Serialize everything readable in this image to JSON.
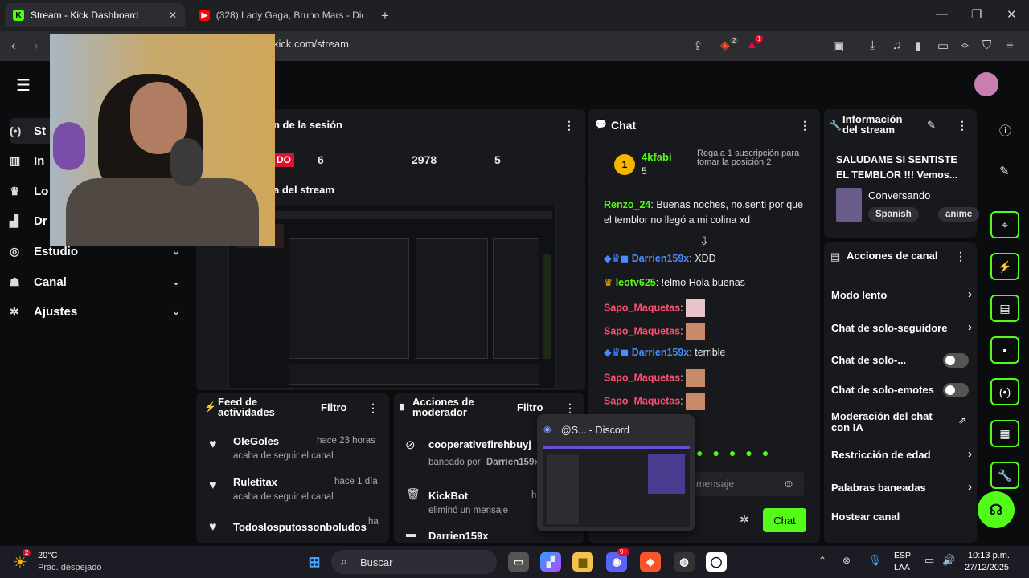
{
  "browser": {
    "tabs": [
      {
        "label": "Stream - Kick Dashboard",
        "icon": "kick-icon",
        "active": true
      },
      {
        "label": "(328) Lady Gaga, Bruno Mars - Die W",
        "icon": "youtube-icon",
        "active": false
      }
    ],
    "url": "kick.com/stream",
    "shield_badge": "2",
    "alert_badge": "1"
  },
  "sidebar": {
    "items": [
      {
        "label": "St",
        "icon": "broadcast-icon"
      },
      {
        "label": "In",
        "icon": "chart-icon"
      },
      {
        "label": "Lo",
        "icon": "trophy-icon"
      },
      {
        "label": "Dr",
        "icon": "drops-icon"
      },
      {
        "label": "Estudio",
        "icon": "studio-icon"
      },
      {
        "label": "Canal",
        "icon": "channel-icon"
      },
      {
        "label": "Ajustes",
        "icon": "settings-icon"
      }
    ]
  },
  "session": {
    "title": "n de la sesión",
    "live_label": "DO",
    "stats": [
      "6",
      "2978",
      "5"
    ],
    "preview_title": "a del stream"
  },
  "feed": {
    "title": "Feed de actividades",
    "filter": "Filtro",
    "items": [
      {
        "name": "OleGoles",
        "sub": "acaba de seguir el canal",
        "time": "hace 23 horas"
      },
      {
        "name": "Ruletitax",
        "sub": "acaba de seguir el canal",
        "time": "hace 1 día"
      },
      {
        "name": "Todoslosputossonboludos",
        "sub": "",
        "time": "ha"
      }
    ]
  },
  "modactions": {
    "title": "Acciones de moderador",
    "filter": "Filtro",
    "items": [
      {
        "name": "cooperativefirehbuyj",
        "sub": "baneado por",
        "by": "Darrien159x"
      },
      {
        "name": "KickBot",
        "sub": "eliminó un mensaje",
        "time": "h"
      },
      {
        "name": "Darrien159x",
        "sub": ""
      }
    ]
  },
  "chat": {
    "title": "Chat",
    "gifter": {
      "name": "4kfabi",
      "rank": "1",
      "count": "5",
      "promo": "Regala 1 suscripción para tomar la posición 2"
    },
    "messages": [
      {
        "user": "Renzo_24",
        "text": "Buenas noches, no.senti por que el temblor no llegó a mi colina xd",
        "color": "#53fc18"
      },
      {
        "user": "Darrien159x",
        "text": "XDD",
        "color": "#4a8cff"
      },
      {
        "user": "leotv625",
        "text": "!elmo Hola buenas",
        "color": "#53fc18"
      },
      {
        "user": "Sapo_Maquetas",
        "text": "",
        "color": "#ff4d6d"
      },
      {
        "user": "Sapo_Maquetas",
        "text": "",
        "color": "#ff4d6d"
      },
      {
        "user": "Darrien159x",
        "text": "terrible",
        "color": "#4a8cff"
      },
      {
        "user": "Sapo_Maquetas",
        "text": "",
        "color": "#ff4d6d"
      },
      {
        "user": "Sapo_Maquetas",
        "text": "",
        "color": "#ff4d6d"
      }
    ],
    "input_placeholder": "mensaje",
    "send_label": "Chat"
  },
  "discord_popup": {
    "title": "@S... - Discord"
  },
  "info": {
    "title": "Información del stream",
    "stream_title": "SALUDAME SI SENTISTE EL TEMBLOR !!! Vemos...",
    "category": "Conversando",
    "tags": [
      "Spanish",
      "anime"
    ]
  },
  "channel_actions": {
    "title": "Acciones de canal",
    "items": [
      {
        "label": "Modo lento",
        "control": "chevron"
      },
      {
        "label": "Chat de solo-seguidore",
        "control": "chevron"
      },
      {
        "label": "Chat de solo-...",
        "control": "toggle"
      },
      {
        "label": "Chat de solo-emotes",
        "control": "toggle"
      },
      {
        "label": "Moderación del chat con IA",
        "control": "external"
      },
      {
        "label": "Restricción de edad",
        "control": "chevron"
      },
      {
        "label": "Palabras baneadas",
        "control": "chevron"
      },
      {
        "label": "Hostear canal",
        "control": "none"
      }
    ]
  },
  "taskbar": {
    "weather_temp": "20°C",
    "weather_desc": "Prac. despejado",
    "weather_badge": "2",
    "search_label": "Buscar",
    "lang": "ESP",
    "lang2": "LAA",
    "time": "10:13 p.m.",
    "date": "27/12/2025",
    "discord_badge": "9+"
  },
  "colors": {
    "accent": "#53fc18",
    "panel": "#18191c",
    "bg": "#0b0c0e"
  }
}
